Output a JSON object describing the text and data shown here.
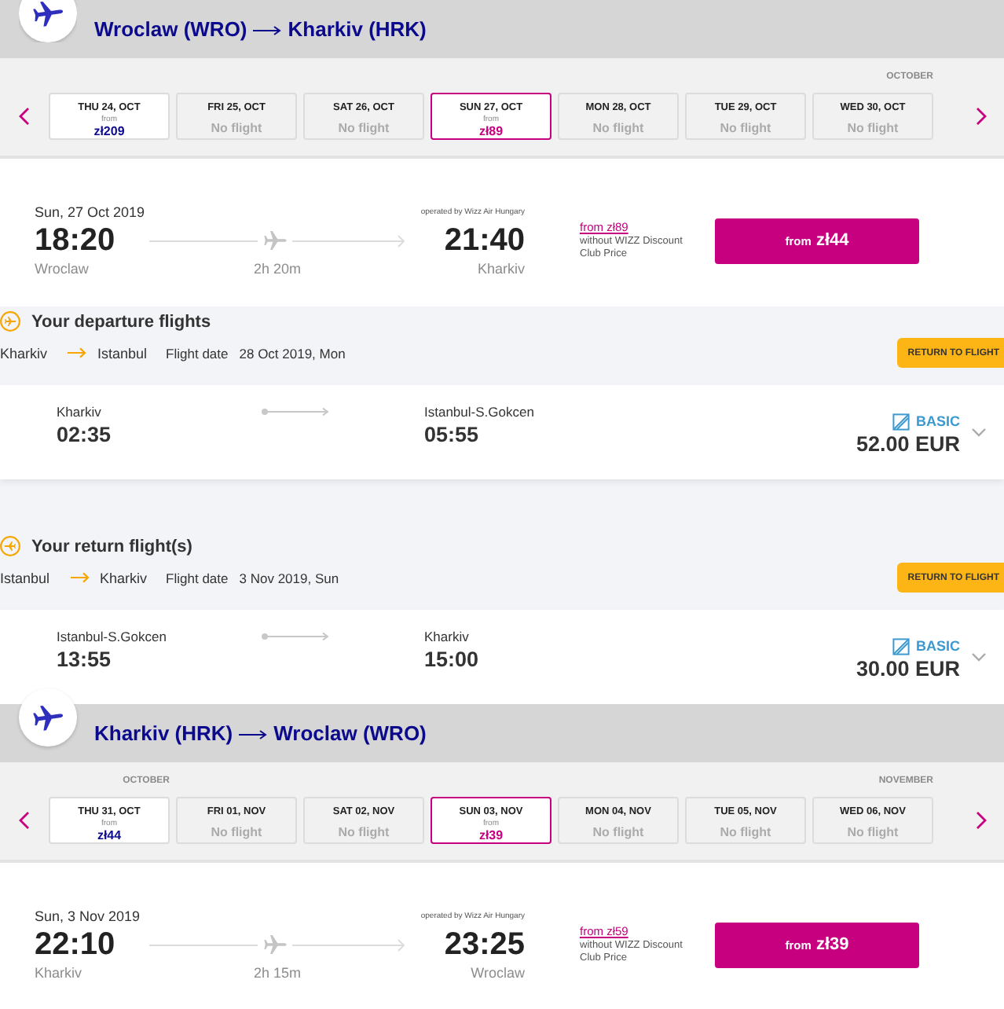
{
  "outbound": {
    "origin": "Wroclaw (WRO)",
    "destination": "Kharkiv (HRK)",
    "dates": [
      {
        "kind": "fare",
        "date": "THU 24, OCT",
        "from": "from",
        "price": "zł209",
        "selected": false
      },
      {
        "kind": "no_flight",
        "date": "FRI 25, OCT",
        "note": "No flight",
        "selected": false
      },
      {
        "kind": "no_flight",
        "date": "SAT 26, OCT",
        "note": "No flight",
        "selected": false
      },
      {
        "kind": "fare",
        "date": "SUN 27, OCT",
        "from": "from",
        "price": "zł89",
        "selected": true
      },
      {
        "kind": "no_flight",
        "date": "MON 28, OCT",
        "note": "No flight",
        "selected": false
      },
      {
        "kind": "no_flight",
        "date": "TUE 29, OCT",
        "note": "No flight",
        "selected": false
      },
      {
        "kind": "no_flight",
        "date": "WED 30, OCT",
        "note": "No flight",
        "selected": false,
        "month": "OCTOBER"
      }
    ],
    "flight": {
      "date": "Sun, 27 Oct 2019",
      "departure_time": "18:20",
      "departure_city": "Wroclaw",
      "duration": "2h 20m",
      "operator": "operated by Wizz Air Hungary",
      "arrival_time": "21:40",
      "arrival_city": "Kharkiv",
      "club_price_link": "from zł89",
      "club_price_note": "without WIZZ Discount Club Price",
      "button_prefix": "from",
      "button_price": "zł44"
    }
  },
  "connections": [
    {
      "kind": "departure",
      "title": "Your departure flights",
      "origin": "Kharkiv",
      "destination": "Istanbul",
      "date_label": "Flight date",
      "date": "28 Oct 2019, Mon",
      "button": "RETURN TO FLIGHT",
      "flight": {
        "departure_airport": "Kharkiv",
        "departure_time": "02:35",
        "arrival_airport": "Istanbul-S.Gokcen",
        "arrival_time": "05:55",
        "fare": "BASIC",
        "price": "52.00 EUR"
      }
    },
    {
      "kind": "return",
      "title": "Your return flight(s)",
      "origin": "Istanbul",
      "destination": "Kharkiv",
      "date_label": "Flight date",
      "date": "3 Nov 2019, Sun",
      "button": "RETURN TO FLIGHT",
      "flight": {
        "departure_airport": "Istanbul-S.Gokcen",
        "departure_time": "13:55",
        "arrival_airport": "Kharkiv",
        "arrival_time": "15:00",
        "fare": "BASIC",
        "price": "30.00 EUR"
      }
    }
  ],
  "inbound": {
    "origin": "Kharkiv (HRK)",
    "destination": "Wroclaw (WRO)",
    "dates": [
      {
        "kind": "fare",
        "date": "THU 31, OCT",
        "from": "from",
        "price": "zł44",
        "selected": false,
        "month": "OCTOBER"
      },
      {
        "kind": "no_flight",
        "date": "FRI 01, NOV",
        "note": "No flight",
        "selected": false
      },
      {
        "kind": "no_flight",
        "date": "SAT 02, NOV",
        "note": "No flight",
        "selected": false
      },
      {
        "kind": "fare",
        "date": "SUN 03, NOV",
        "from": "from",
        "price": "zł39",
        "selected": true
      },
      {
        "kind": "no_flight",
        "date": "MON 04, NOV",
        "note": "No flight",
        "selected": false
      },
      {
        "kind": "no_flight",
        "date": "TUE 05, NOV",
        "note": "No flight",
        "selected": false
      },
      {
        "kind": "no_flight",
        "date": "WED 06, NOV",
        "note": "No flight",
        "selected": false,
        "month": "NOVEMBER"
      }
    ],
    "flight": {
      "date": "Sun, 3 Nov 2019",
      "departure_time": "22:10",
      "departure_city": "Kharkiv",
      "duration": "2h 15m",
      "operator": "operated by Wizz Air Hungary",
      "arrival_time": "23:25",
      "arrival_city": "Wroclaw",
      "club_price_link": "from zł59",
      "club_price_note": "without WIZZ Discount Club Price",
      "button_prefix": "from",
      "button_price": "zł39"
    }
  }
}
